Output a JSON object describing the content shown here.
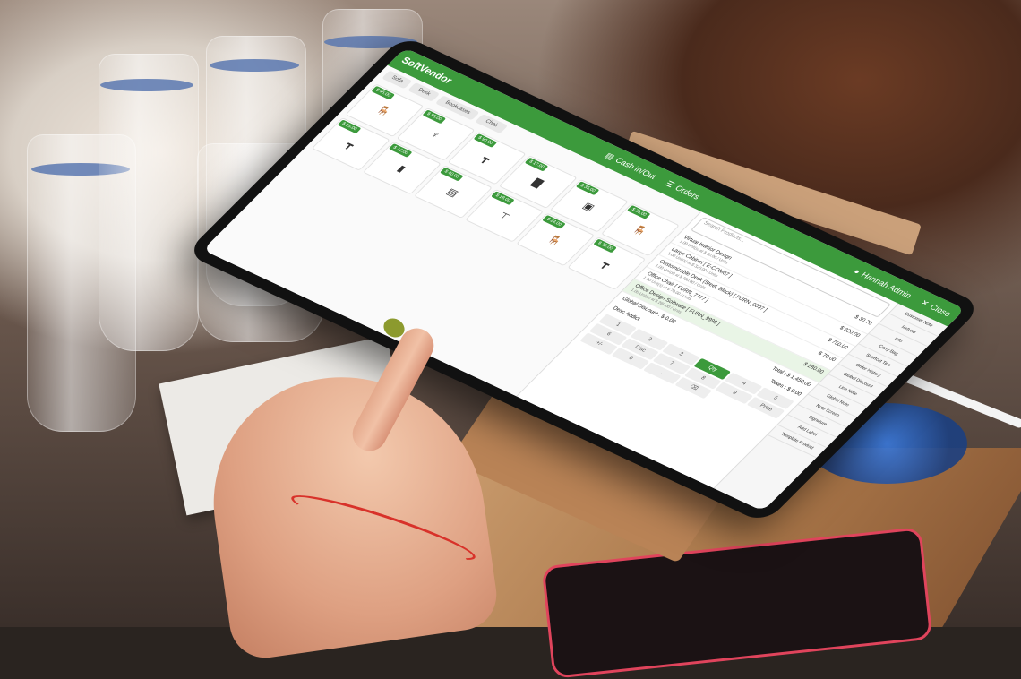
{
  "app": {
    "logo": "SoftVendor",
    "topbar": {
      "tabs": [
        "Cash in/Out",
        "Orders"
      ],
      "user": "Hannah Admin",
      "close": "Close"
    },
    "categories": [
      "Sofa",
      "Desk",
      "Bookcases",
      "Chair"
    ],
    "search_placeholder": "Search Products...",
    "products": [
      {
        "price": "$ 45.00",
        "icon": "chair-icon"
      },
      {
        "price": "$ 95.00",
        "icon": "lamp-icon"
      },
      {
        "price": "$ 90.00",
        "icon": "table-icon"
      },
      {
        "price": "$ 17.00",
        "icon": "cabinet-icon"
      },
      {
        "price": "$ 35.00",
        "icon": "box-icon"
      },
      {
        "price": "$ 35.00",
        "icon": "chair-icon"
      },
      {
        "price": "$ 15.00",
        "icon": "desk-icon"
      },
      {
        "price": "$ 12.00",
        "icon": "bin-icon"
      },
      {
        "price": "$ 40.00",
        "icon": "shelf-icon"
      },
      {
        "price": "$ 18.00",
        "icon": "stool-icon"
      },
      {
        "price": "$ 24.00",
        "icon": "chair-icon"
      },
      {
        "price": "$ 12.00",
        "icon": "desk-icon"
      }
    ],
    "cart": [
      {
        "name": "Virtual Interior Design",
        "sub": "1.00 Unit(s) at $ 30.00 / Units",
        "price": "$ 30.70",
        "highlight": false
      },
      {
        "name": "Large Cabinet [ E-COM07 ]",
        "sub": "1.00 Unit(s) at $ 320.00 / Units",
        "price": "$ 320.00",
        "highlight": false
      },
      {
        "name": "Customizable Desk (Steel, Black) [ FURN_0097 ]",
        "sub": "1.00 Unit(s) at $ 750.00 / Units",
        "price": "$ 750.00",
        "highlight": false
      },
      {
        "name": "Office Chair [ FURN_7777 ]",
        "sub": "1.00 Unit(s) at $ 70.00 / Units",
        "price": "$ 70.00",
        "highlight": false
      },
      {
        "name": "Office Design Software [ FURN_9999 ]",
        "sub": "1.00 Unit(s) at $ 280.00 / Units",
        "price": "$ 280.00",
        "highlight": true
      }
    ],
    "global_discount": "Global Discount : $ 0.00",
    "total": "Total : $ 1,450.00",
    "taxes": "Taxes : $ 0.00",
    "keypad": [
      "1",
      "2",
      "3",
      "Qty",
      "4",
      "5",
      "6",
      "Disc",
      "7",
      "8",
      "9",
      "Price",
      "+/-",
      "0",
      ".",
      "⌫"
    ],
    "side_buttons": [
      "Customer Note",
      "Refund",
      "Info",
      "Carry Bag",
      "Shortcut Tips",
      "Order History",
      "Global Discount",
      "Line Note",
      "Global Note",
      "Note Screen",
      "Signature",
      "Add Label",
      "Template Product"
    ],
    "deselect": "Desc Addict"
  }
}
